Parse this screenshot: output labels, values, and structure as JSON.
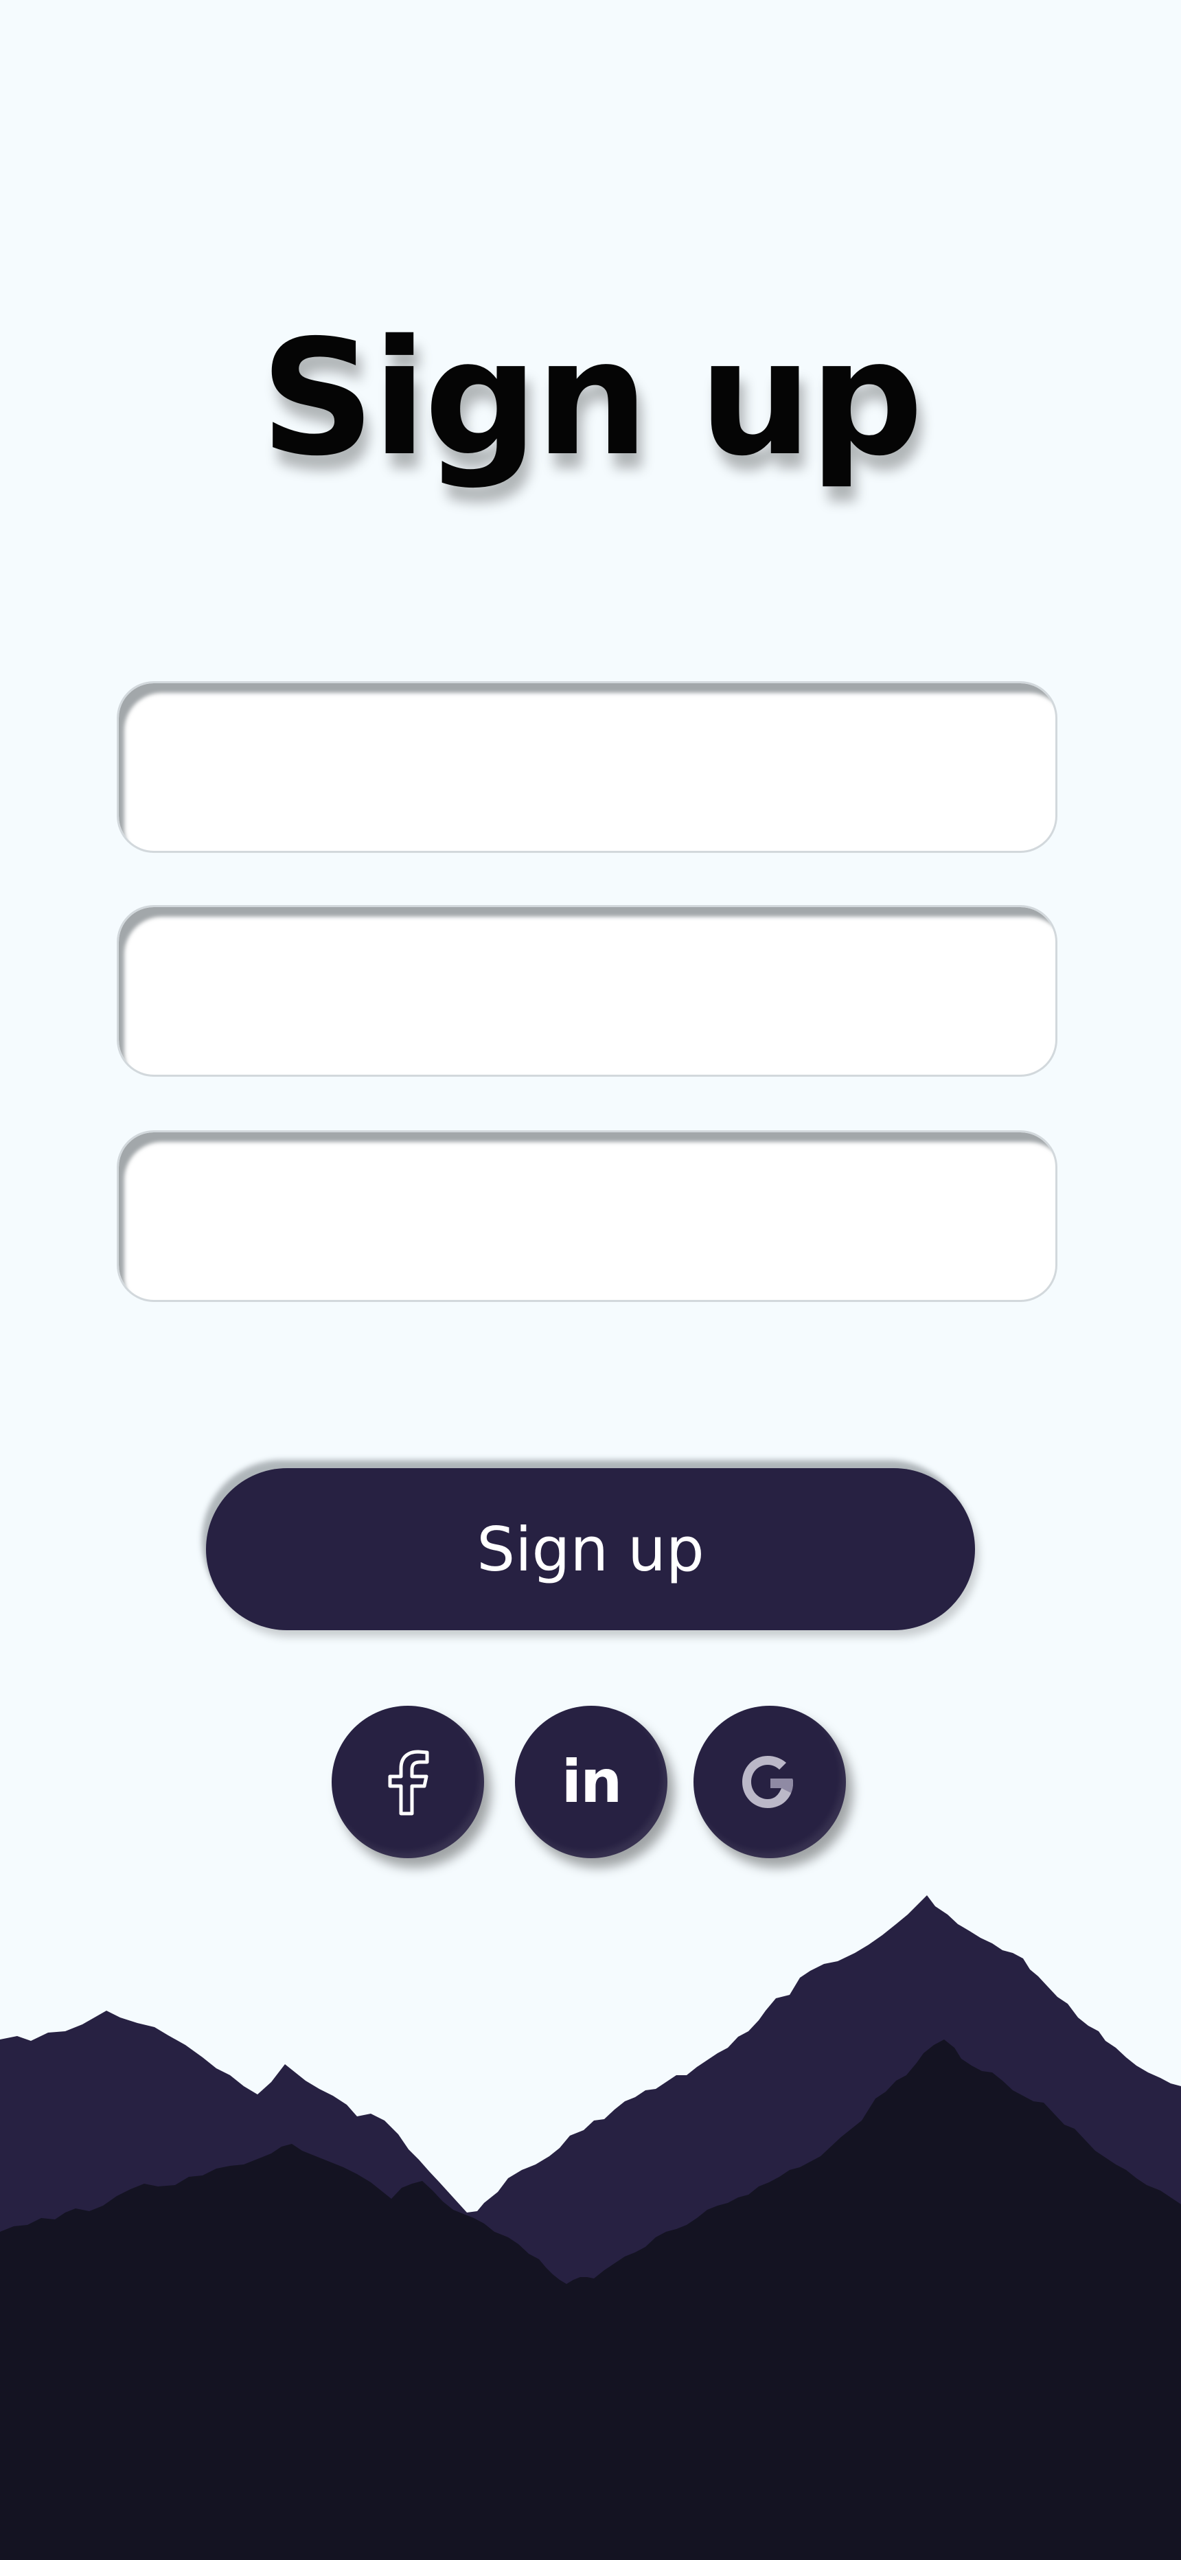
{
  "page": {
    "title": "Sign up"
  },
  "form": {
    "fields": [
      {
        "value": "",
        "placeholder": ""
      },
      {
        "value": "",
        "placeholder": ""
      },
      {
        "value": "",
        "placeholder": ""
      }
    ],
    "submit_label": "Sign up"
  },
  "social": {
    "icons": [
      "facebook-icon",
      "linkedin-icon",
      "google-icon"
    ],
    "linkedin_glyph": "in"
  },
  "colors": {
    "background": "#f5fbfe",
    "accent": "#272142",
    "mountain_back": "#272142",
    "mountain_front": "#141322",
    "title": "#050505"
  }
}
